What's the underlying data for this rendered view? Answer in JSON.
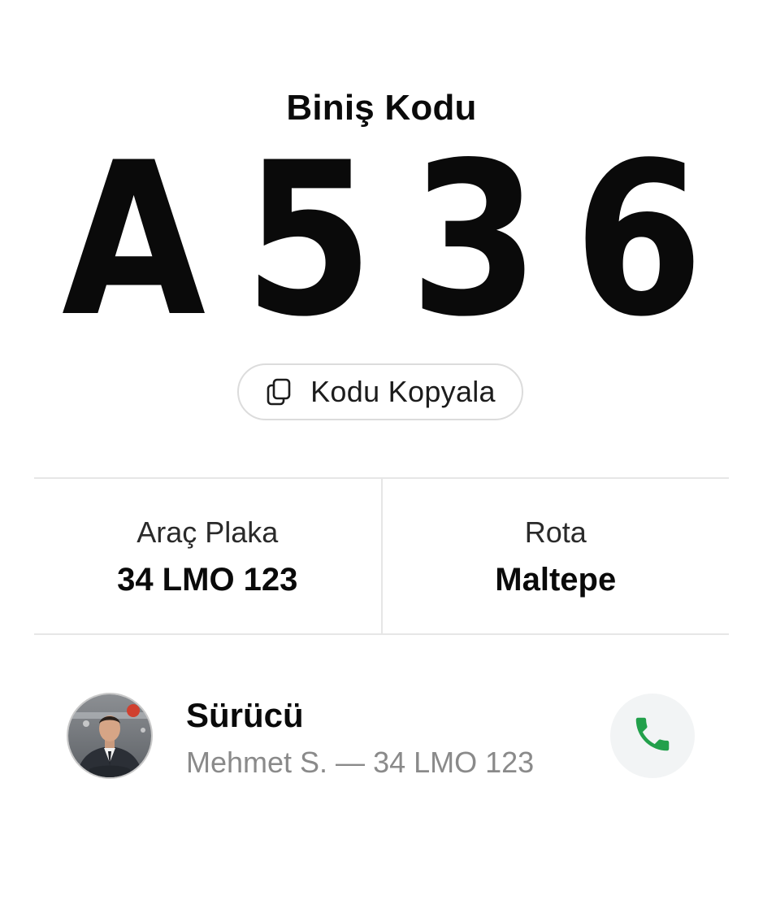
{
  "header": {
    "title": "Biniş Kodu"
  },
  "code": {
    "chars": [
      "A",
      "5",
      "3",
      "6"
    ]
  },
  "copy_button": {
    "label": "Kodu Kopyala",
    "icon": "copy-icon"
  },
  "info": {
    "plate": {
      "label": "Araç Plaka",
      "value": "34 LMO 123"
    },
    "route": {
      "label": "Rota",
      "value": "Maltepe"
    }
  },
  "driver": {
    "title": "Sürücü",
    "subtitle": "Mehmet S. — 34 LMO 123",
    "avatar": "driver-photo",
    "call_icon": "phone-icon"
  },
  "colors": {
    "text": "#0a0a0a",
    "muted": "#8a8a8a",
    "border": "#e6e6e6",
    "call_bg": "#f2f4f5",
    "call_icon": "#22a04b"
  }
}
